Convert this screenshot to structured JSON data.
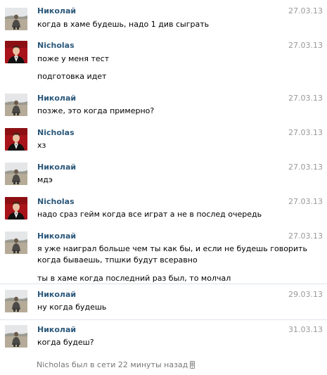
{
  "users": {
    "nikolai": {
      "name": "Николай",
      "avatar_icon": "nikolai-avatar-photo"
    },
    "nicholas": {
      "name": "Nicholas",
      "avatar_icon": "nicholas-avatar-photo"
    }
  },
  "messages": [
    {
      "author": "Николай",
      "date": "27.03.13",
      "lines": [
        "когда в хаме будешь, надо 1 див сыграть"
      ]
    },
    {
      "author": "Nicholas",
      "date": "27.03.13",
      "lines": [
        "поже у меня тест",
        "подготовка идет"
      ]
    },
    {
      "author": "Николай",
      "date": "27.03.13",
      "lines": [
        "позже, это когда примерно?"
      ]
    },
    {
      "author": "Nicholas",
      "date": "27.03.13",
      "lines": [
        "хз"
      ]
    },
    {
      "author": "Николай",
      "date": "27.03.13",
      "lines": [
        "мдэ"
      ]
    },
    {
      "author": "Nicholas",
      "date": "27.03.13",
      "lines": [
        "надо сраз гейм когда все играт а не в послед очередь"
      ]
    },
    {
      "author": "Николай",
      "date": "27.03.13",
      "lines": [
        "я уже наиграл больше чем ты как бы, и если не будешь говорить",
        "когда бываешь, тпшки будут всеравно",
        "ты в хаме когда последний раз был, то молчал"
      ]
    },
    {
      "author": "Николай",
      "date": "29.03.13",
      "lines": [
        "ну когда будешь"
      ]
    },
    {
      "author": "Николай",
      "date": "31.03.13",
      "lines": [
        "когда будеш?"
      ]
    }
  ],
  "status": {
    "text": "Nicholas был в сети 22 минуты назад",
    "icon": "mobile-phone-icon"
  },
  "colors": {
    "author": "#2b587a",
    "date": "#999999",
    "status": "#777777",
    "divider": "#dde3ea"
  }
}
